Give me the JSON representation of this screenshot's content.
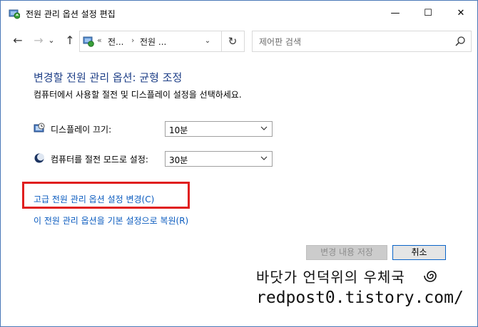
{
  "window": {
    "title": "전원 관리 옵션 설정 편집",
    "minimize_glyph": "—",
    "maximize_glyph": "☐",
    "close_glyph": "✕"
  },
  "nav": {
    "back_glyph": "←",
    "forward_glyph": "→",
    "recent_glyph": "⌄",
    "up_glyph": "↑",
    "breadcrumb": [
      "«",
      "전...",
      "›",
      "전원 ..."
    ],
    "refresh_glyph": "↻",
    "dropdown_glyph": "⌄",
    "search_placeholder": "제어판 검색"
  },
  "content": {
    "heading": "변경할 전원 관리 옵션: 균형 조정",
    "description": "컴퓨터에서 사용할 절전 및 디스플레이 설정을 선택하세요.",
    "display_off_label": "디스플레이 끄기:",
    "display_off_value": "10분",
    "sleep_label": "컴퓨터를 절전 모드로 설정:",
    "sleep_value": "30분",
    "advanced_link": "고급 전원 관리 옵션 설정 변경(C)",
    "restore_link": "이 전원 관리 옵션을 기본 설정으로 복원(R)",
    "save_button": "변경 내용 저장",
    "cancel_button": "취소"
  },
  "watermark": {
    "line1": "바닷가 언덕위의 우체국",
    "line2": "redpost0.tistory.com/"
  },
  "icons": {
    "title_icon": "power-options-icon",
    "address_icon": "control-panel-icon",
    "display_icon": "monitor-clock-icon",
    "sleep_icon": "moon-icon",
    "search_icon": "search-icon"
  },
  "colors": {
    "heading": "#1e3f87",
    "link": "#0a5bbf",
    "highlight": "#e01e1e",
    "window_border": "#4a78b8"
  }
}
